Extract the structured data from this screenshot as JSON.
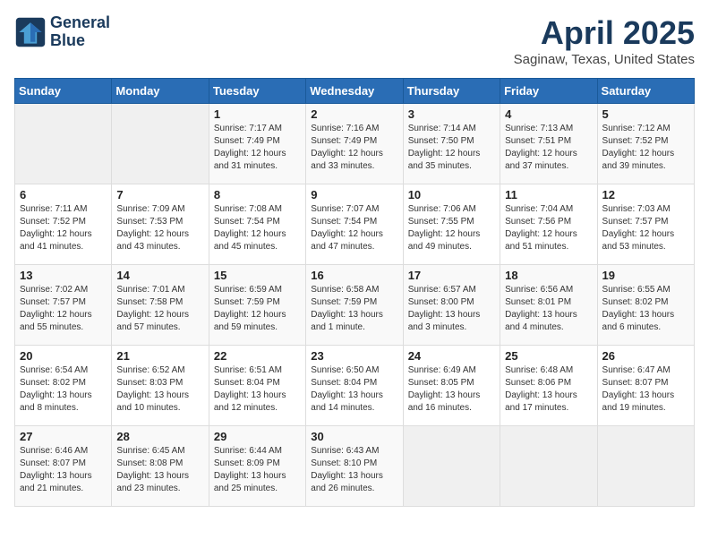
{
  "header": {
    "logo_line1": "General",
    "logo_line2": "Blue",
    "month": "April 2025",
    "location": "Saginaw, Texas, United States"
  },
  "weekdays": [
    "Sunday",
    "Monday",
    "Tuesday",
    "Wednesday",
    "Thursday",
    "Friday",
    "Saturday"
  ],
  "weeks": [
    [
      {
        "day": "",
        "info": ""
      },
      {
        "day": "",
        "info": ""
      },
      {
        "day": "1",
        "info": "Sunrise: 7:17 AM\nSunset: 7:49 PM\nDaylight: 12 hours\nand 31 minutes."
      },
      {
        "day": "2",
        "info": "Sunrise: 7:16 AM\nSunset: 7:49 PM\nDaylight: 12 hours\nand 33 minutes."
      },
      {
        "day": "3",
        "info": "Sunrise: 7:14 AM\nSunset: 7:50 PM\nDaylight: 12 hours\nand 35 minutes."
      },
      {
        "day": "4",
        "info": "Sunrise: 7:13 AM\nSunset: 7:51 PM\nDaylight: 12 hours\nand 37 minutes."
      },
      {
        "day": "5",
        "info": "Sunrise: 7:12 AM\nSunset: 7:52 PM\nDaylight: 12 hours\nand 39 minutes."
      }
    ],
    [
      {
        "day": "6",
        "info": "Sunrise: 7:11 AM\nSunset: 7:52 PM\nDaylight: 12 hours\nand 41 minutes."
      },
      {
        "day": "7",
        "info": "Sunrise: 7:09 AM\nSunset: 7:53 PM\nDaylight: 12 hours\nand 43 minutes."
      },
      {
        "day": "8",
        "info": "Sunrise: 7:08 AM\nSunset: 7:54 PM\nDaylight: 12 hours\nand 45 minutes."
      },
      {
        "day": "9",
        "info": "Sunrise: 7:07 AM\nSunset: 7:54 PM\nDaylight: 12 hours\nand 47 minutes."
      },
      {
        "day": "10",
        "info": "Sunrise: 7:06 AM\nSunset: 7:55 PM\nDaylight: 12 hours\nand 49 minutes."
      },
      {
        "day": "11",
        "info": "Sunrise: 7:04 AM\nSunset: 7:56 PM\nDaylight: 12 hours\nand 51 minutes."
      },
      {
        "day": "12",
        "info": "Sunrise: 7:03 AM\nSunset: 7:57 PM\nDaylight: 12 hours\nand 53 minutes."
      }
    ],
    [
      {
        "day": "13",
        "info": "Sunrise: 7:02 AM\nSunset: 7:57 PM\nDaylight: 12 hours\nand 55 minutes."
      },
      {
        "day": "14",
        "info": "Sunrise: 7:01 AM\nSunset: 7:58 PM\nDaylight: 12 hours\nand 57 minutes."
      },
      {
        "day": "15",
        "info": "Sunrise: 6:59 AM\nSunset: 7:59 PM\nDaylight: 12 hours\nand 59 minutes."
      },
      {
        "day": "16",
        "info": "Sunrise: 6:58 AM\nSunset: 7:59 PM\nDaylight: 13 hours\nand 1 minute."
      },
      {
        "day": "17",
        "info": "Sunrise: 6:57 AM\nSunset: 8:00 PM\nDaylight: 13 hours\nand 3 minutes."
      },
      {
        "day": "18",
        "info": "Sunrise: 6:56 AM\nSunset: 8:01 PM\nDaylight: 13 hours\nand 4 minutes."
      },
      {
        "day": "19",
        "info": "Sunrise: 6:55 AM\nSunset: 8:02 PM\nDaylight: 13 hours\nand 6 minutes."
      }
    ],
    [
      {
        "day": "20",
        "info": "Sunrise: 6:54 AM\nSunset: 8:02 PM\nDaylight: 13 hours\nand 8 minutes."
      },
      {
        "day": "21",
        "info": "Sunrise: 6:52 AM\nSunset: 8:03 PM\nDaylight: 13 hours\nand 10 minutes."
      },
      {
        "day": "22",
        "info": "Sunrise: 6:51 AM\nSunset: 8:04 PM\nDaylight: 13 hours\nand 12 minutes."
      },
      {
        "day": "23",
        "info": "Sunrise: 6:50 AM\nSunset: 8:04 PM\nDaylight: 13 hours\nand 14 minutes."
      },
      {
        "day": "24",
        "info": "Sunrise: 6:49 AM\nSunset: 8:05 PM\nDaylight: 13 hours\nand 16 minutes."
      },
      {
        "day": "25",
        "info": "Sunrise: 6:48 AM\nSunset: 8:06 PM\nDaylight: 13 hours\nand 17 minutes."
      },
      {
        "day": "26",
        "info": "Sunrise: 6:47 AM\nSunset: 8:07 PM\nDaylight: 13 hours\nand 19 minutes."
      }
    ],
    [
      {
        "day": "27",
        "info": "Sunrise: 6:46 AM\nSunset: 8:07 PM\nDaylight: 13 hours\nand 21 minutes."
      },
      {
        "day": "28",
        "info": "Sunrise: 6:45 AM\nSunset: 8:08 PM\nDaylight: 13 hours\nand 23 minutes."
      },
      {
        "day": "29",
        "info": "Sunrise: 6:44 AM\nSunset: 8:09 PM\nDaylight: 13 hours\nand 25 minutes."
      },
      {
        "day": "30",
        "info": "Sunrise: 6:43 AM\nSunset: 8:10 PM\nDaylight: 13 hours\nand 26 minutes."
      },
      {
        "day": "",
        "info": ""
      },
      {
        "day": "",
        "info": ""
      },
      {
        "day": "",
        "info": ""
      }
    ]
  ]
}
